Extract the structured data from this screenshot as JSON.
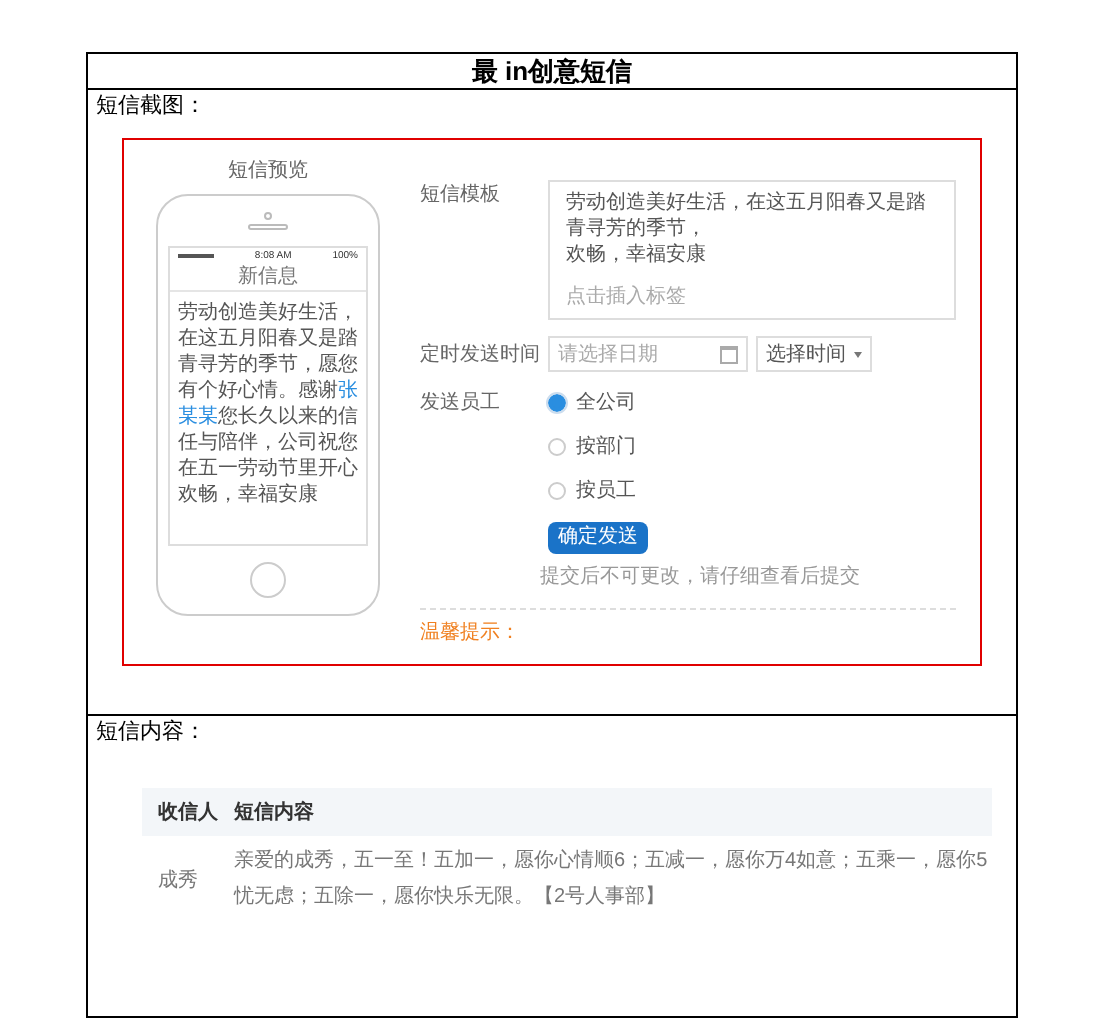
{
  "document": {
    "title": "最 in创意短信",
    "sections": [
      {
        "kind": "screenshot",
        "label": "短信截图：",
        "preview": {
          "title": "短信预览",
          "status_time": "8:08 AM",
          "status_battery": "100%",
          "screen_title": "新信息",
          "message_before": "劳动创造美好生活，在这五月阳春又是踏青寻芳的季节，愿您有个好心情。感谢",
          "message_highlight": "张某某",
          "message_after": "您长久以来的信任与陪伴，公司祝您在五一劳动节里开心欢畅，幸福安康"
        },
        "form": {
          "template_label": "短信模板",
          "template_lines": [
            "劳动创造美好生活，在这五月阳春又是踏青寻芳的季节，",
            "欢畅，幸福安康"
          ],
          "template_hint": "点击插入标签",
          "time_label": "定时发送时间",
          "date_placeholder": "请选择日期",
          "time_select": "选择时间",
          "staff_label": "发送员工",
          "options": [
            {
              "label": "全公司",
              "selected": true
            },
            {
              "label": "按部门",
              "selected": false
            },
            {
              "label": "按员工",
              "selected": false
            }
          ],
          "submit": "确定发送",
          "note": "提交后不可更改，请仔细查看后提交",
          "tip": "温馨提示："
        }
      },
      {
        "kind": "table",
        "label": "短信内容：",
        "columns": [
          "收信人",
          "短信内容"
        ],
        "rows": [
          [
            "成秀",
            "亲爱的成秀，五一至！五加一，愿你心情顺6；五减一，愿你万4如意；五乘一，愿你5忧无虑；五除一，愿你快乐无限。【2号人事部】"
          ]
        ]
      }
    ]
  }
}
